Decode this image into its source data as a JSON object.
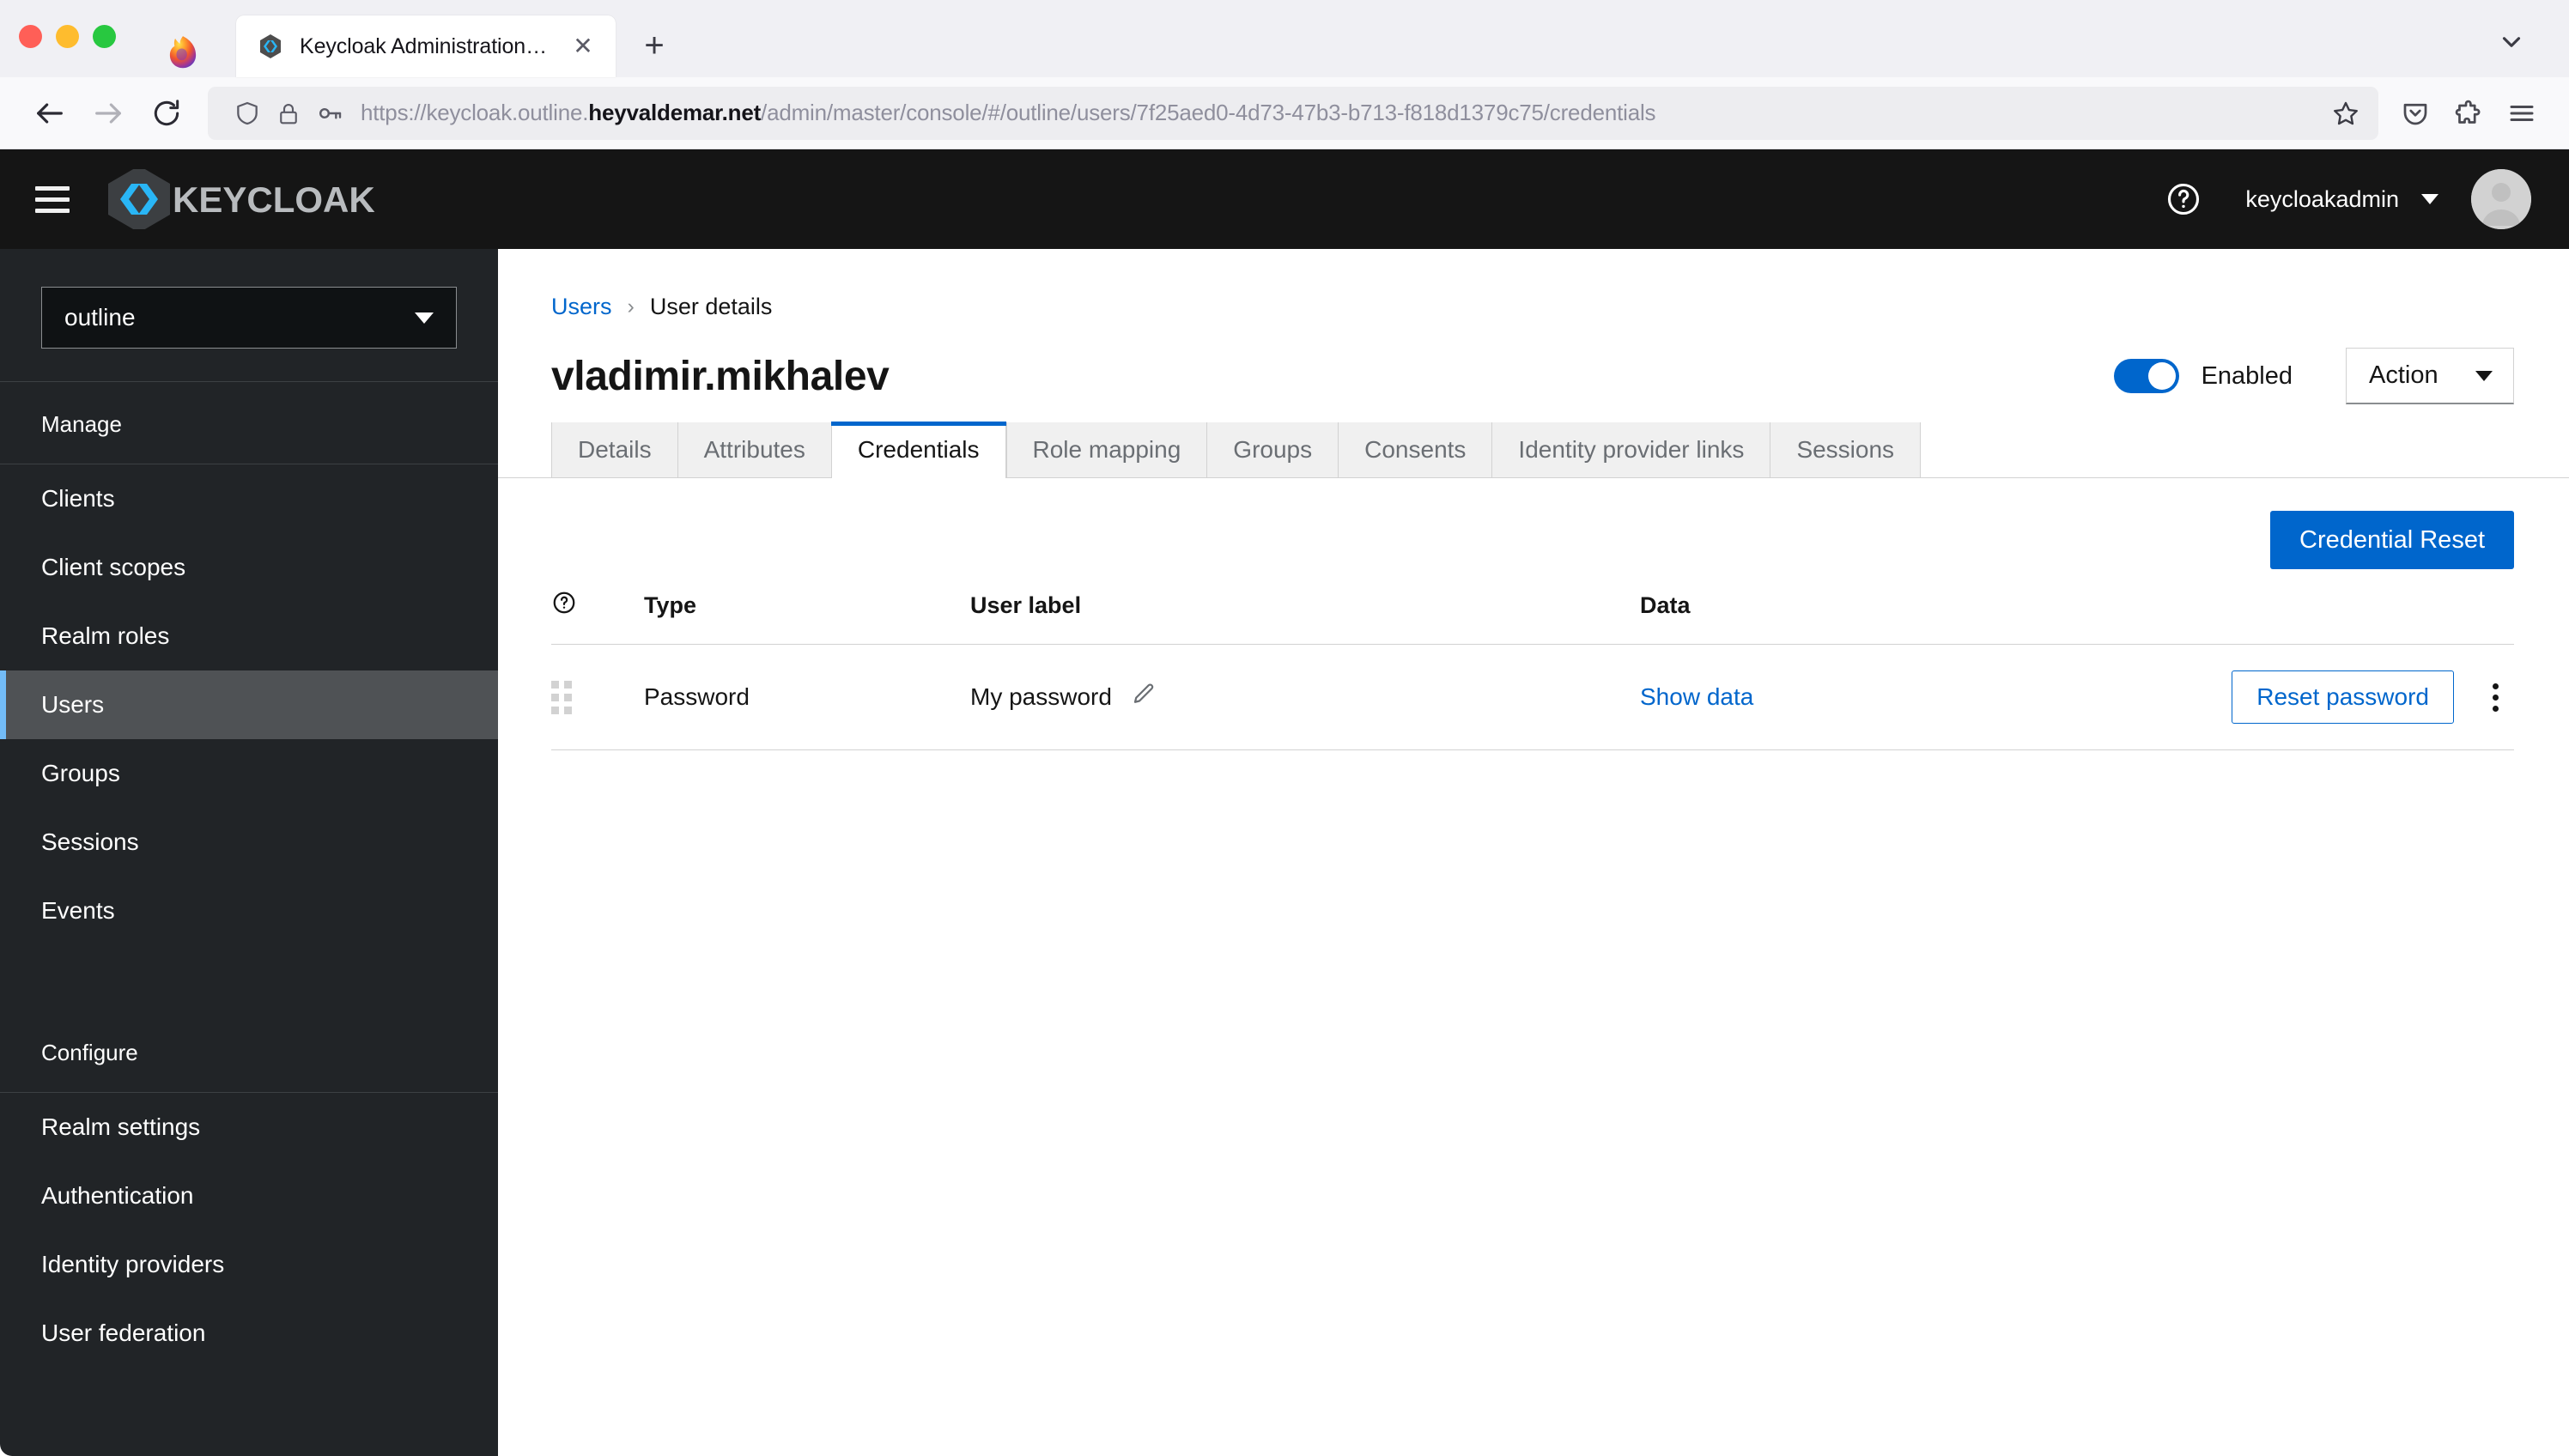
{
  "browser": {
    "tab": {
      "title": "Keycloak Administration UI",
      "close_label": "✕",
      "favicon_name": "keycloak-favicon"
    },
    "new_tab_label": "+",
    "nav": {
      "back_label": "←",
      "forward_label": "→",
      "reload_label": "↻"
    },
    "url": {
      "prefix": "https://keycloak.outline.",
      "domain": "heyvaldemar.net",
      "path": "/admin/master/console/#/outline/users/7f25aed0-4d73-47b3-b713-f818d1379c75/credentials",
      "full": "https://keycloak.outline.heyvaldemar.net/admin/master/console/#/outline/users/7f25aed0-4d73-47b3-b713-f818d1379c75/credentials"
    },
    "icons": {
      "shield": "tracking-protection-shield-icon",
      "lock": "site-security-lock-icon",
      "key": "saved-login-key-icon",
      "star": "bookmark-star-icon",
      "pocket": "save-to-pocket-icon",
      "extensions": "extensions-puzzle-icon",
      "menu": "app-menu-icon",
      "list_all_tabs": "list-all-tabs-chevron-icon"
    }
  },
  "header": {
    "brand": "KEYCLOAK",
    "help_label": "?",
    "username": "keycloakadmin"
  },
  "sidebar": {
    "realm": "outline",
    "groups": [
      {
        "title": "Manage",
        "items": [
          {
            "label": "Clients",
            "active": false
          },
          {
            "label": "Client scopes",
            "active": false
          },
          {
            "label": "Realm roles",
            "active": false
          },
          {
            "label": "Users",
            "active": true
          },
          {
            "label": "Groups",
            "active": false
          },
          {
            "label": "Sessions",
            "active": false
          },
          {
            "label": "Events",
            "active": false
          }
        ]
      },
      {
        "title": "Configure",
        "items": [
          {
            "label": "Realm settings",
            "active": false
          },
          {
            "label": "Authentication",
            "active": false
          },
          {
            "label": "Identity providers",
            "active": false
          },
          {
            "label": "User federation",
            "active": false
          }
        ]
      }
    ]
  },
  "main": {
    "breadcrumb": {
      "parent": "Users",
      "separator": "›",
      "current": "User details"
    },
    "page_title": "vladimir.mikhalev",
    "enabled_label": "Enabled",
    "enabled_state": true,
    "action_button": "Action",
    "tabs": [
      {
        "label": "Details",
        "active": false
      },
      {
        "label": "Attributes",
        "active": false
      },
      {
        "label": "Credentials",
        "active": true
      },
      {
        "label": "Role mapping",
        "active": false
      },
      {
        "label": "Groups",
        "active": false
      },
      {
        "label": "Consents",
        "active": false
      },
      {
        "label": "Identity provider links",
        "active": false
      },
      {
        "label": "Sessions",
        "active": false
      }
    ],
    "credential_reset_button": "Credential Reset",
    "table": {
      "headers": [
        "",
        "Type",
        "User label",
        "Data",
        ""
      ],
      "rows": [
        {
          "type": "Password",
          "user_label": "My password",
          "data_link": "Show data",
          "reset_button": "Reset password"
        }
      ]
    }
  },
  "colors": {
    "accent_blue": "#0066cc",
    "header_black": "#151515",
    "sidebar_dark": "#212427",
    "sidebar_active": "#4f5255",
    "active_bar": "#73bcf7"
  }
}
